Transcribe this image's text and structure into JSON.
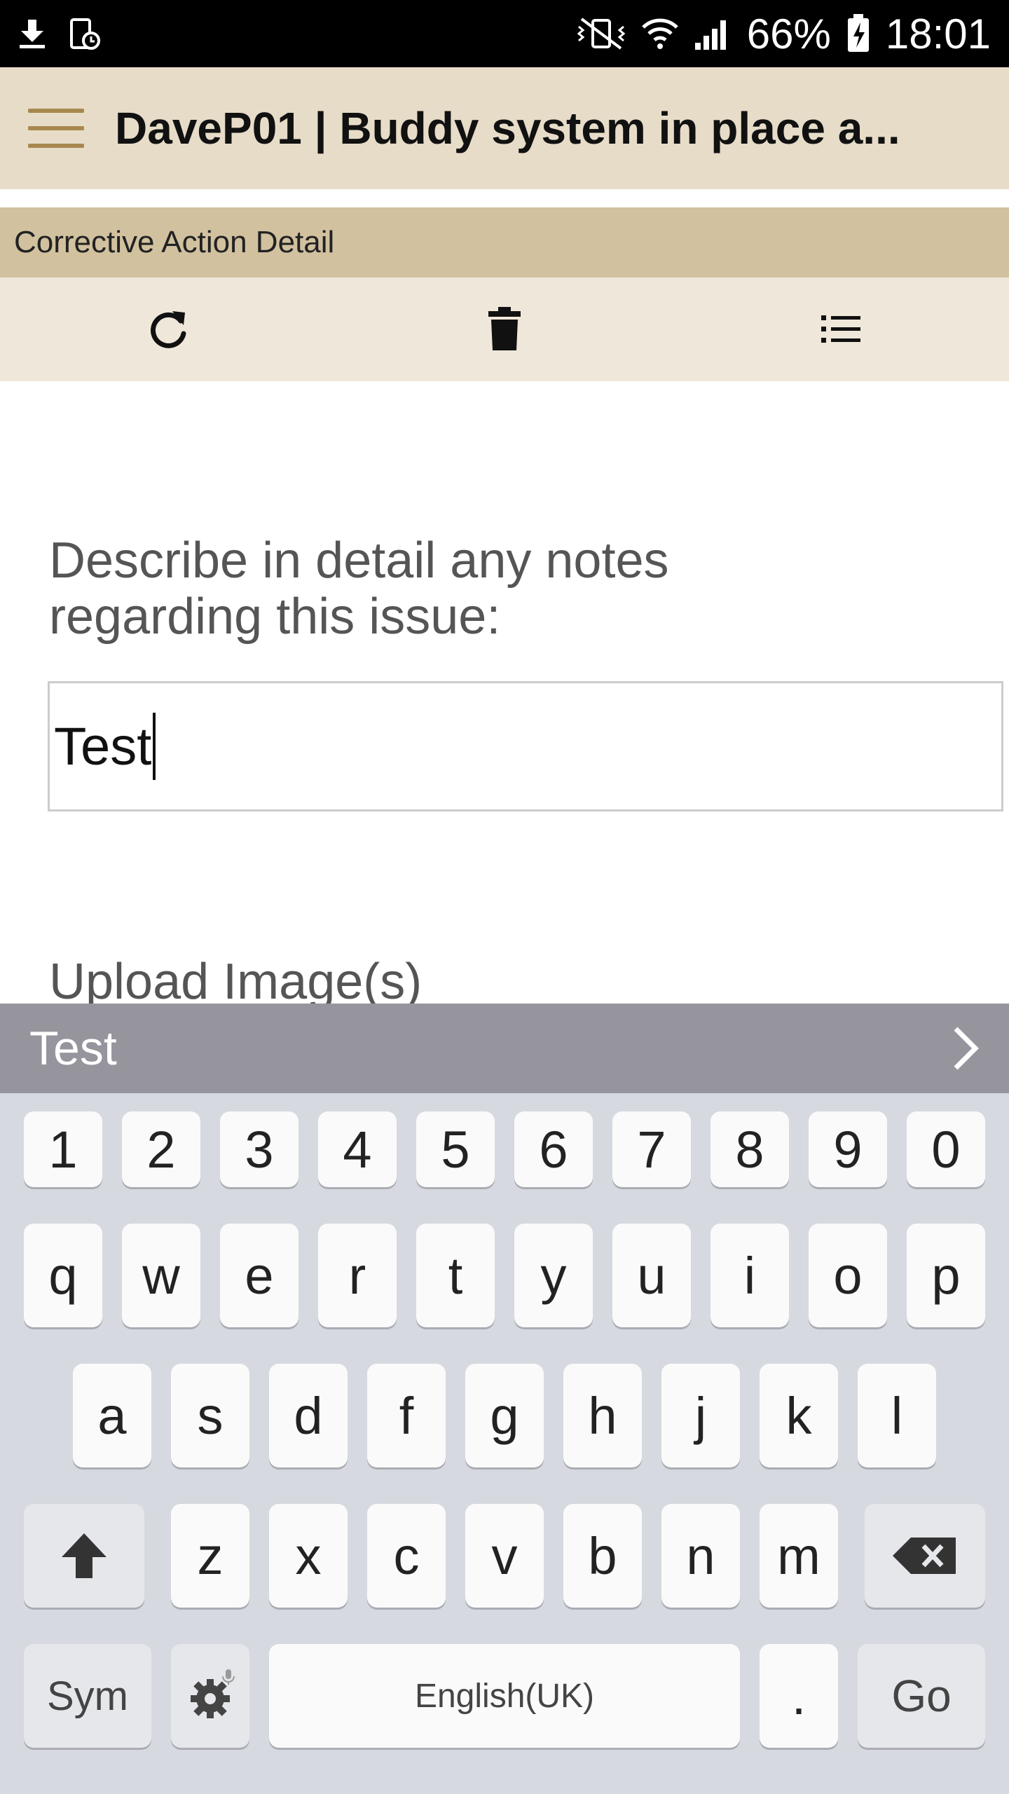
{
  "status_bar": {
    "battery": "66%",
    "time": "18:01"
  },
  "app_bar": {
    "title": "DaveP01 | Buddy system in place a..."
  },
  "section": {
    "title": "Corrective Action Detail"
  },
  "toolbar": {
    "icons": [
      "refresh-icon",
      "delete-icon",
      "list-icon"
    ]
  },
  "form": {
    "notes_label": "Describe in detail any notes regarding this issue:",
    "notes_value": "Test",
    "upload_label": "Upload Image(s)"
  },
  "keyboard": {
    "suggestion": "Test",
    "row_numbers": [
      "1",
      "2",
      "3",
      "4",
      "5",
      "6",
      "7",
      "8",
      "9",
      "0"
    ],
    "row_1": [
      "q",
      "w",
      "e",
      "r",
      "t",
      "y",
      "u",
      "i",
      "o",
      "p"
    ],
    "row_2": [
      "a",
      "s",
      "d",
      "f",
      "g",
      "h",
      "j",
      "k",
      "l"
    ],
    "row_3": [
      "z",
      "x",
      "c",
      "v",
      "b",
      "n",
      "m"
    ],
    "sym": "Sym",
    "space": "English(UK)",
    "period": ".",
    "go": "Go"
  }
}
